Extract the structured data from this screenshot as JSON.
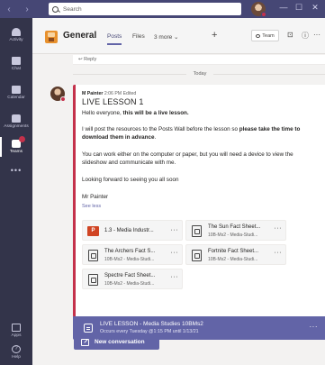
{
  "titlebar": {
    "back": "‹",
    "forward": "›",
    "search_placeholder": "Search",
    "minimize": "—",
    "maximize": "☐",
    "close": "✕"
  },
  "rail": {
    "items": [
      {
        "label": "Activity",
        "icon": "bell-icon"
      },
      {
        "label": "Chat",
        "icon": "chat-icon"
      },
      {
        "label": "Calendar",
        "icon": "calendar-icon"
      },
      {
        "label": "Assignments",
        "icon": "assignments-icon"
      },
      {
        "label": "Teams",
        "icon": "teams-icon",
        "active": true
      },
      {
        "label": "",
        "icon": "more-icon"
      }
    ],
    "more": "•••",
    "apps": "Apps",
    "help": "Help"
  },
  "header": {
    "channel": "General",
    "tabs": [
      "Posts",
      "Files",
      "3 more ⌄"
    ],
    "plus": "+",
    "team_button": "Team",
    "video_icon": "⊡",
    "info_icon": "ⓘ",
    "more": "···"
  },
  "feed": {
    "reply_label": "↩ Reply",
    "date_divider": "Today",
    "post": {
      "author": "M Painter",
      "time": "2:06 PM",
      "edited": "Edited",
      "subject": "LIVE LESSON 1",
      "p1_normal": "Hello everyone, ",
      "p1_bold": "this will be a live lesson.",
      "p2_normal": "I will post the resources to the Posts Wall before the lesson so ",
      "p2_bold": "please take the time to download them in advance",
      "p2_end": ".",
      "p3": "You can work either on the computer or paper, but you will need a device to view the slideshow and communicate with me.",
      "p4": "Looking forward to seeing you all soon",
      "p5": "Mr Painter",
      "see_less": "See less",
      "attachments": [
        {
          "name": "1.3 - Media Industr...",
          "sub": "",
          "type": "pptx"
        },
        {
          "name": "The Sun Fact Sheet...",
          "sub": "10B-Ms2 - Media-Studi...",
          "type": "file"
        },
        {
          "name": "The Archers Fact S...",
          "sub": "10B-Ms2 - Media-Studi...",
          "type": "file"
        },
        {
          "name": "Fortnite Fact Sheet...",
          "sub": "10B-Ms2 - Media-Studi...",
          "type": "file"
        },
        {
          "name": "Spectre Fact Sheet...",
          "sub": "10B-Ms2 - Media-Studi...",
          "type": "file"
        }
      ],
      "attachment_more": "···"
    },
    "meeting": {
      "title": "LIVE LESSON - Media Studies 10BMs2",
      "subtitle": "Occurs every Tuesday @1:15 PM until 1/13/21",
      "more": "···"
    },
    "new_conversation": "New conversation"
  }
}
